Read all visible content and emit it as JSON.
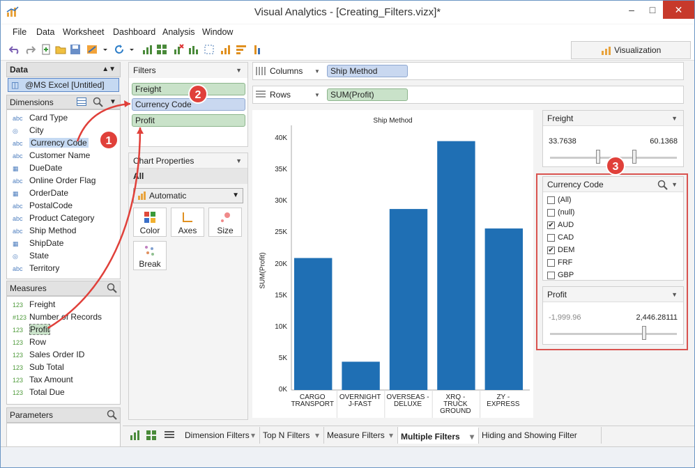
{
  "window": {
    "title": "Visual Analytics - [Creating_Filters.vizx]*"
  },
  "menu": [
    "File",
    "Data",
    "Worksheet",
    "Dashboard",
    "Analysis",
    "Window"
  ],
  "toolbar": {
    "viz_label": "Visualization"
  },
  "data_panel": {
    "header": "Data",
    "source": "@MS Excel [Untitled]",
    "dimensions_header": "Dimensions",
    "dimensions": [
      {
        "type": "abc",
        "label": "Card Type"
      },
      {
        "type": "geo",
        "label": "City"
      },
      {
        "type": "abc",
        "label": "Currency Code"
      },
      {
        "type": "abc",
        "label": "Customer Name"
      },
      {
        "type": "date",
        "label": "DueDate"
      },
      {
        "type": "abc",
        "label": "Online Order Flag"
      },
      {
        "type": "date",
        "label": "OrderDate"
      },
      {
        "type": "abc",
        "label": "PostalCode"
      },
      {
        "type": "abc",
        "label": "Product Category"
      },
      {
        "type": "abc",
        "label": "Ship Method"
      },
      {
        "type": "date",
        "label": "ShipDate"
      },
      {
        "type": "geo",
        "label": "State"
      },
      {
        "type": "abc",
        "label": "Territory"
      }
    ],
    "measures_header": "Measures",
    "measures": [
      {
        "type": "123",
        "label": "Freight"
      },
      {
        "type": "#123",
        "label": "Number of Records"
      },
      {
        "type": "123",
        "label": "Profit"
      },
      {
        "type": "123",
        "label": "Row"
      },
      {
        "type": "123",
        "label": "Sales Order ID"
      },
      {
        "type": "123",
        "label": "Sub Total"
      },
      {
        "type": "123",
        "label": "Tax Amount"
      },
      {
        "type": "123",
        "label": "Total Due"
      }
    ],
    "parameters_header": "Parameters"
  },
  "filters_panel": {
    "header": "Filters",
    "pills": [
      "Freight",
      "Currency Code",
      "Profit"
    ]
  },
  "chart_properties": {
    "header": "Chart Properties",
    "all_label": "All",
    "mark_type": "Automatic",
    "cards": [
      "Color",
      "Axes",
      "Size",
      "Break"
    ]
  },
  "shelves": {
    "columns_label": "Columns",
    "columns_pill": "Ship Method",
    "rows_label": "Rows",
    "rows_pill": "SUM(Profit)"
  },
  "chart_data": {
    "type": "bar",
    "title": "Ship Method",
    "xlabel": "",
    "ylabel": "SUM(Profit)",
    "categories": [
      "CARGO TRANSPORT",
      "OVERNIGHT J-FAST",
      "OVERSEAS - DELUXE",
      "XRQ - TRUCK GROUND",
      "ZY - EXPRESS"
    ],
    "category_lines": [
      [
        "CARGO",
        "TRANSPORT"
      ],
      [
        "OVERNIGHT",
        "J-FAST"
      ],
      [
        "OVERSEAS -",
        "DELUXE"
      ],
      [
        "XRQ -",
        "TRUCK",
        "GROUND"
      ],
      [
        "ZY -",
        "EXPRESS"
      ]
    ],
    "values": [
      21000,
      4500,
      28800,
      39600,
      25700
    ],
    "yticks": [
      "0K",
      "5K",
      "10K",
      "15K",
      "20K",
      "25K",
      "30K",
      "35K",
      "40K"
    ],
    "ylim": [
      0,
      41000
    ],
    "color": "#1f6fb4"
  },
  "freight_filter": {
    "header": "Freight",
    "min": "33.7638",
    "max": "60.1368"
  },
  "currency_filter": {
    "header": "Currency Code",
    "options": [
      {
        "label": "(All)",
        "checked": false
      },
      {
        "label": "(null)",
        "checked": false
      },
      {
        "label": "AUD",
        "checked": true
      },
      {
        "label": "CAD",
        "checked": false
      },
      {
        "label": "DEM",
        "checked": true
      },
      {
        "label": "FRF",
        "checked": false
      },
      {
        "label": "GBP",
        "checked": false
      }
    ]
  },
  "profit_filter": {
    "header": "Profit",
    "min": "-1,999.96",
    "max": "2,446.28111"
  },
  "sheet_tabs": [
    "Dimension Filters",
    "Top N Filters",
    "Measure Filters",
    "Multiple Filters",
    "Hiding and Showing Filter Decks"
  ],
  "active_tab": "Multiple Filters",
  "annotations": [
    "1",
    "2",
    "3"
  ],
  "colors": {
    "accent_red": "#e0403a",
    "bar": "#1f6fb4",
    "pill_green": "#c9e2c9",
    "pill_blue": "#c9d8f0"
  }
}
